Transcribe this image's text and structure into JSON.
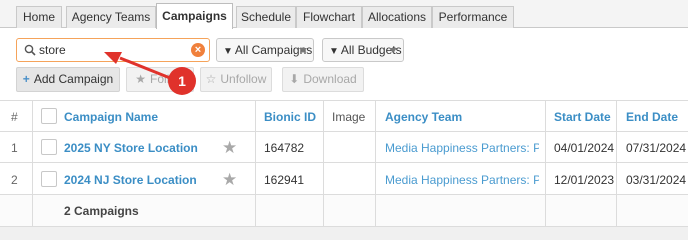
{
  "tabs": [
    {
      "label": "Home"
    },
    {
      "label": "Agency Teams"
    },
    {
      "label": "Campaigns"
    },
    {
      "label": "Schedule"
    },
    {
      "label": "Flowchart"
    },
    {
      "label": "Allocations"
    },
    {
      "label": "Performance"
    }
  ],
  "active_tab": "Campaigns",
  "search": {
    "value": "store",
    "placeholder": ""
  },
  "filters": {
    "campaigns": "All Campaigns",
    "budgets": "All Budgets"
  },
  "toolbar": {
    "add_label": "Add Campaign",
    "follow_label": "Follow",
    "unfollow_label": "Unfollow",
    "download_label": "Download"
  },
  "callout": {
    "number": "1"
  },
  "table": {
    "columns": [
      "#",
      "Campaign Name",
      "Bionic ID",
      "Image",
      "Agency Team",
      "Start Date",
      "End Date"
    ],
    "rows": [
      {
        "num": "1",
        "name": "2025 NY Store Location",
        "bionic_id": "164782",
        "image": "",
        "team": "Media Happiness Partners: Pat'…",
        "start": "04/01/2024",
        "end": "07/31/2024"
      },
      {
        "num": "2",
        "name": "2024 NJ Store Location",
        "bionic_id": "162941",
        "image": "",
        "team": "Media Happiness Partners: Pat'…",
        "start": "12/01/2023",
        "end": "03/31/2024"
      }
    ],
    "footer": "2 Campaigns"
  },
  "colors": {
    "link": "#3b8ec5",
    "accent_orange": "#f0803c",
    "callout_red": "#e0322b"
  }
}
